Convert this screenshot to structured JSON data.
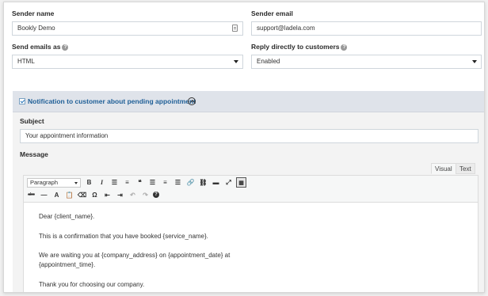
{
  "sender_name": {
    "label": "Sender name",
    "value": "Bookly Demo",
    "icon": "contact-card-icon"
  },
  "sender_email": {
    "label": "Sender email",
    "value": "support@ladela.com"
  },
  "send_emails_as": {
    "label": "Send emails as",
    "help_icon": "?",
    "value": "HTML"
  },
  "reply_directly": {
    "label": "Reply directly to customers",
    "help_icon": "?",
    "value": "Enabled"
  },
  "notification": {
    "title": "Notification to customer about pending appointment",
    "enabled": true,
    "subject_label": "Subject",
    "subject_value": "Your appointment information",
    "message_label": "Message"
  },
  "editor": {
    "tabs": {
      "visual": "Visual",
      "text": "Text"
    },
    "format_select": "Paragraph",
    "toolbar_row1": [
      {
        "name": "bold-icon",
        "glyph": "B"
      },
      {
        "name": "italic-icon",
        "glyph": "I"
      },
      {
        "name": "bullet-list-icon",
        "glyph": "☰"
      },
      {
        "name": "numbered-list-icon",
        "glyph": "≡"
      },
      {
        "name": "blockquote-icon",
        "glyph": "❝"
      },
      {
        "name": "align-left-icon",
        "glyph": "☰"
      },
      {
        "name": "align-center-icon",
        "glyph": "≡"
      },
      {
        "name": "align-right-icon",
        "glyph": "☰"
      },
      {
        "name": "insert-link-icon",
        "glyph": "🔗"
      },
      {
        "name": "remove-link-icon",
        "glyph": "⛓"
      },
      {
        "name": "read-more-icon",
        "glyph": "▬"
      },
      {
        "name": "fullscreen-icon",
        "glyph": "⤢"
      },
      {
        "name": "toolbar-toggle-icon",
        "glyph": "▦"
      }
    ],
    "toolbar_row2": [
      {
        "name": "strikethrough-icon",
        "glyph": "abc"
      },
      {
        "name": "horizontal-line-icon",
        "glyph": "—"
      },
      {
        "name": "text-color-icon",
        "glyph": "A"
      },
      {
        "name": "paste-text-icon",
        "glyph": "📋"
      },
      {
        "name": "clear-formatting-icon",
        "glyph": "⌫"
      },
      {
        "name": "special-character-icon",
        "glyph": "Ω"
      },
      {
        "name": "outdent-icon",
        "glyph": "⇤"
      },
      {
        "name": "indent-icon",
        "glyph": "⇥"
      },
      {
        "name": "undo-icon",
        "glyph": "↶"
      },
      {
        "name": "redo-icon",
        "glyph": "↷"
      },
      {
        "name": "help-icon",
        "glyph": "?"
      }
    ],
    "paragraphs": [
      "Dear {client_name}.",
      "This is a confirmation that you have booked {service_name}.",
      "We are waiting you at {company_address} on {appointment_date} at",
      "{appointment_time}.",
      "Thank you for choosing our company."
    ]
  }
}
